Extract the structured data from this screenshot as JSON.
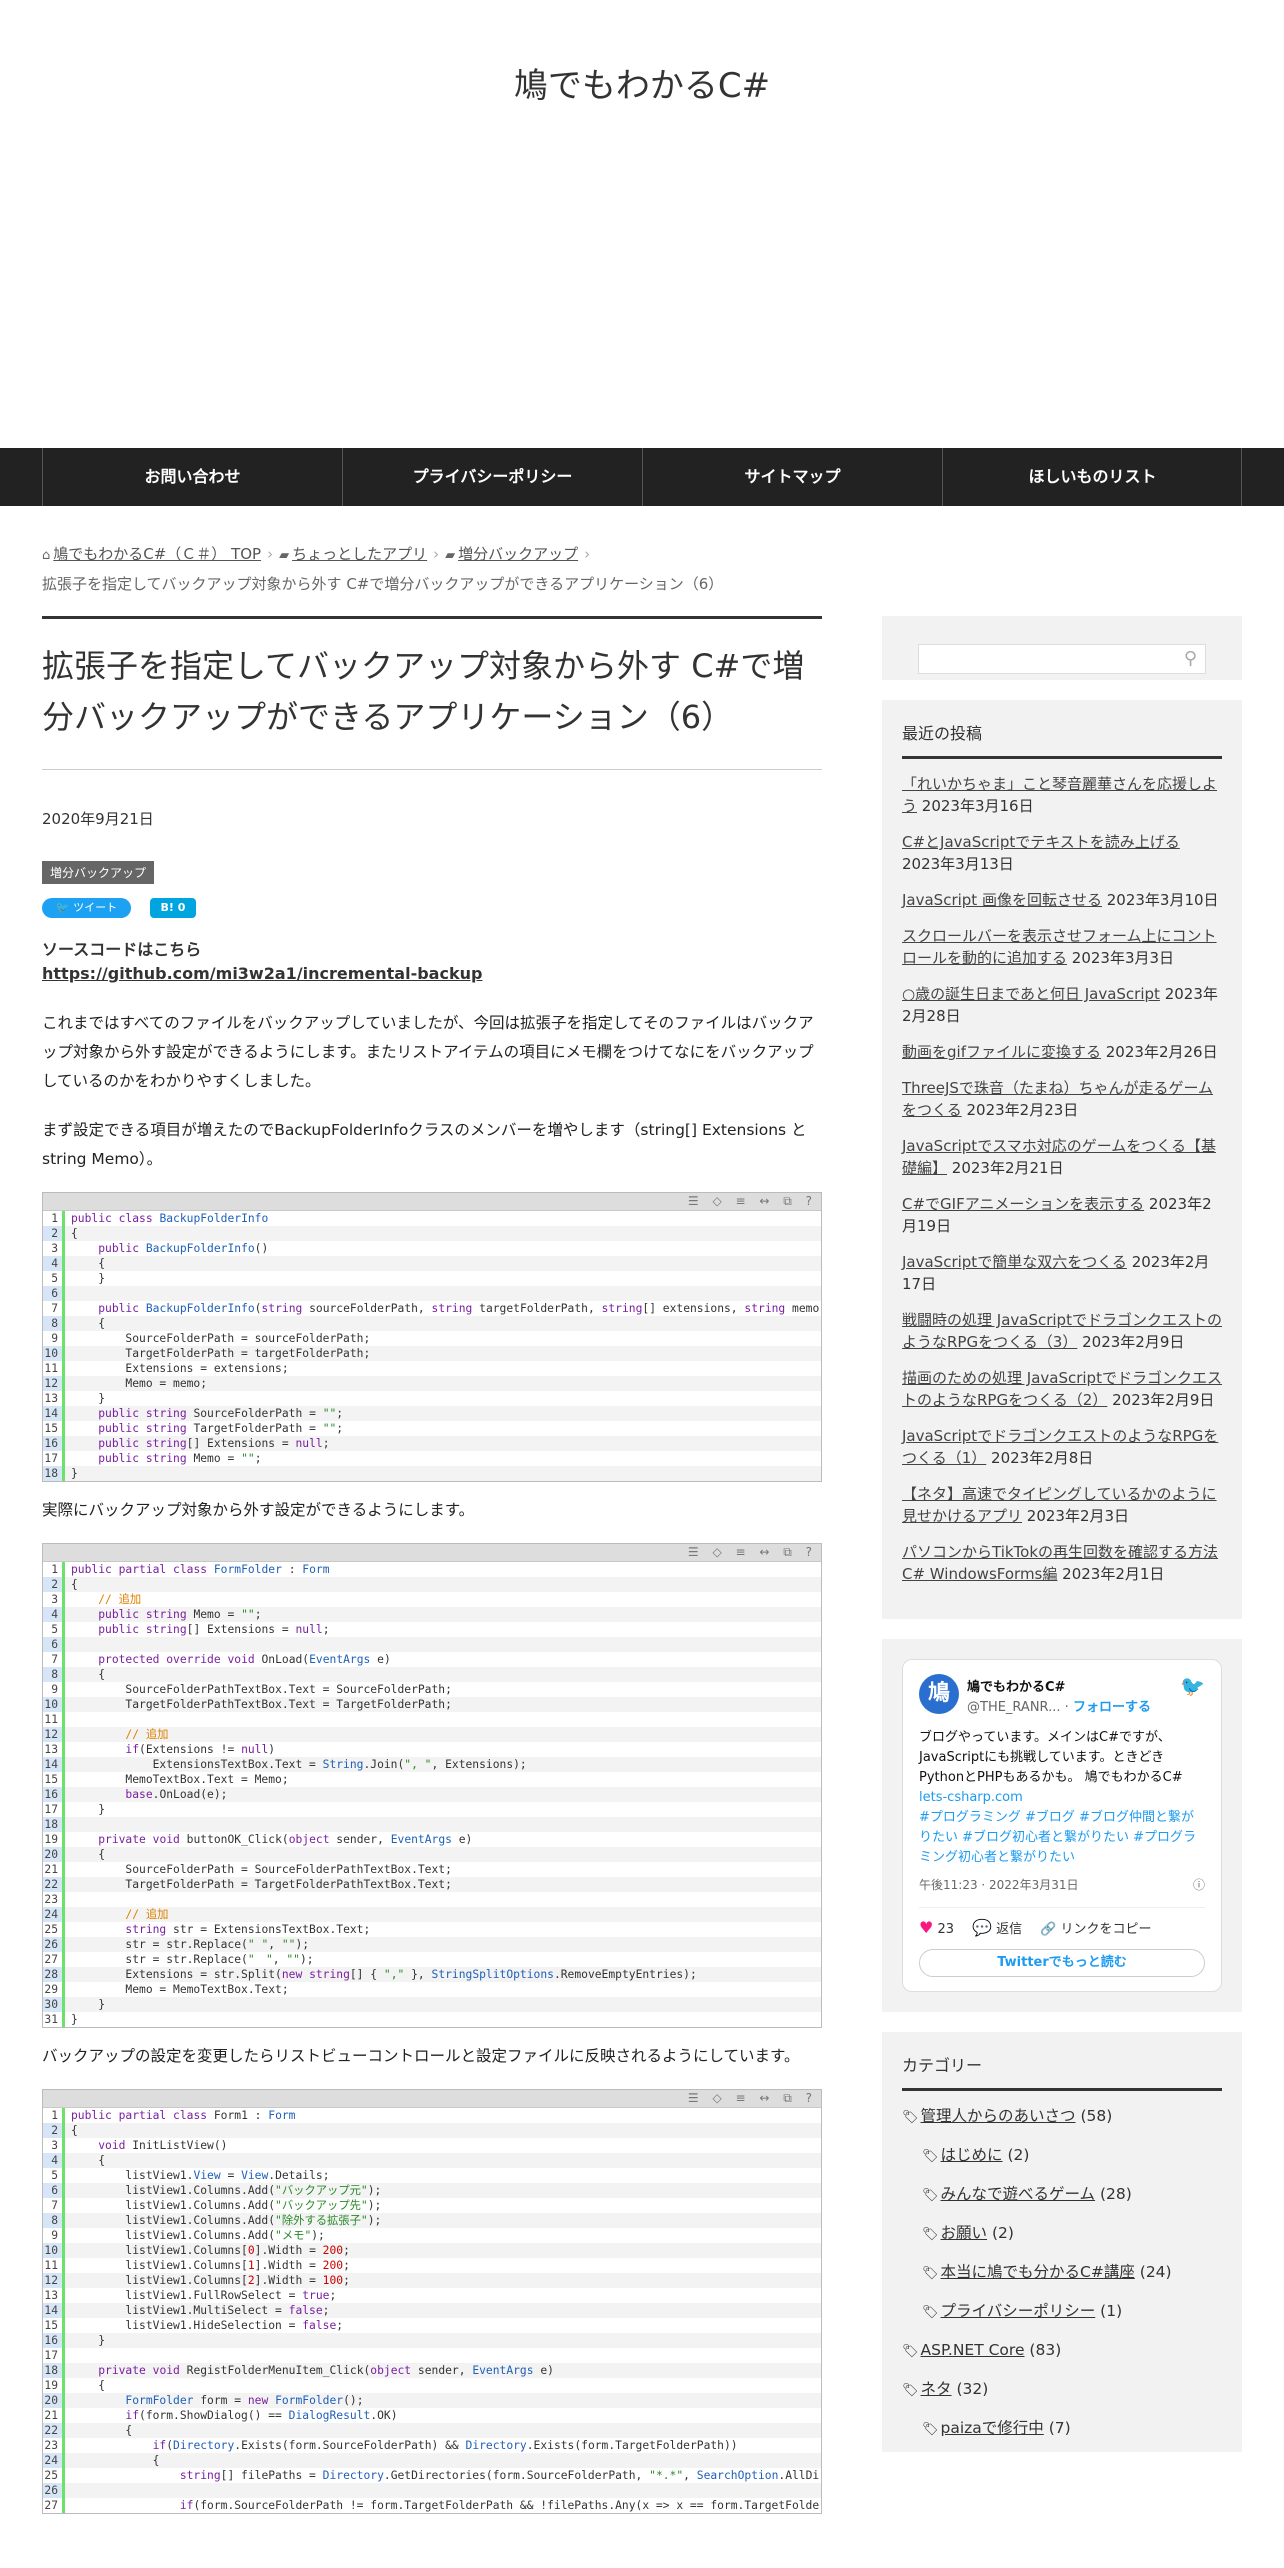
{
  "site": {
    "title": "鳩でもわかるC#"
  },
  "nav": [
    "お問い合わせ",
    "プライバシーポリシー",
    "サイトマップ",
    "ほしいものリスト"
  ],
  "breadcrumb": {
    "home": "鳩でもわかるC#（Ｃ＃） TOP",
    "cat1": "ちょっとしたアプリ",
    "cat2": "増分バックアップ",
    "current": "拡張子を指定してバックアップ対象から外す C#で増分バックアップができるアプリケーション（6）"
  },
  "entry": {
    "title": "拡張子を指定してバックアップ対象から外す C#で増分バックアップができるアプリケーション（6）",
    "date": "2020年9月21日",
    "tag": "増分バックアップ",
    "tweet_label": "ツイート",
    "hatena_label": "B!",
    "hatena_count": "0",
    "source_label": "ソースコードはこちら",
    "source_url": "https://github.com/mi3w2a1/incremental-backup",
    "para1": "これまではすべてのファイルをバックアップしていましたが、今回は拡張子を指定してそのファイルはバックアップ対象から外す設定ができるようにします。またリストアイテムの項目にメモ欄をつけてなにをバックアップしているのかをわかりやすくしました。",
    "para2": "まず設定できる項目が増えたのでBackupFolderInfoクラスのメンバーを増やします（string[] Extensions と string Memo）。",
    "para3": "実際にバックアップ対象から外す設定ができるようにします。",
    "para4": "バックアップの設定を変更したらリストビューコントロールと設定ファイルに反映されるようにしています。"
  },
  "code_blocks": [
    {
      "toolbar": "☰ ◇ ≡ ↔ ⧉ ?",
      "lines": [
        "public class BackupFolderInfo",
        "{",
        "    public BackupFolderInfo()",
        "    {",
        "    }",
        "",
        "    public BackupFolderInfo(string sourceFolderPath, string targetFolderPath, string[] extensions, string memo)",
        "    {",
        "        SourceFolderPath = sourceFolderPath;",
        "        TargetFolderPath = targetFolderPath;",
        "        Extensions = extensions;",
        "        Memo = memo;",
        "    }",
        "    public string SourceFolderPath = \"\";",
        "    public string TargetFolderPath = \"\";",
        "    public string[] Extensions = null;",
        "    public string Memo = \"\";",
        "}"
      ]
    },
    {
      "toolbar": "☰ ◇ ≡ ↔ ⧉ ?",
      "lines": [
        "public partial class FormFolder : Form",
        "{",
        "    // 追加",
        "    public string Memo = \"\";",
        "    public string[] Extensions = null;",
        "",
        "    protected override void OnLoad(EventArgs e)",
        "    {",
        "        SourceFolderPathTextBox.Text = SourceFolderPath;",
        "        TargetFolderPathTextBox.Text = TargetFolderPath;",
        "",
        "        // 追加",
        "        if(Extensions != null)",
        "            ExtensionsTextBox.Text = String.Join(\", \", Extensions);",
        "        MemoTextBox.Text = Memo;",
        "        base.OnLoad(e);",
        "    }",
        "",
        "    private void buttonOK_Click(object sender, EventArgs e)",
        "    {",
        "        SourceFolderPath = SourceFolderPathTextBox.Text;",
        "        TargetFolderPath = TargetFolderPathTextBox.Text;",
        "",
        "        // 追加",
        "        string str = ExtensionsTextBox.Text;",
        "        str = str.Replace(\" \", \"\");",
        "        str = str.Replace(\"　\", \"\");",
        "        Extensions = str.Split(new string[] { \",\" }, StringSplitOptions.RemoveEmptyEntries);",
        "        Memo = MemoTextBox.Text;",
        "    }",
        "}"
      ]
    },
    {
      "toolbar": "☰ ◇ ≡ ↔ ⧉ ?",
      "lines": [
        "public partial class Form1 : Form",
        "{",
        "    void InitListView()",
        "    {",
        "        listView1.View = View.Details;",
        "        listView1.Columns.Add(\"バックアップ元\");",
        "        listView1.Columns.Add(\"バックアップ先\");",
        "        listView1.Columns.Add(\"除外する拡張子\");",
        "        listView1.Columns.Add(\"メモ\");",
        "        listView1.Columns[0].Width = 200;",
        "        listView1.Columns[1].Width = 200;",
        "        listView1.Columns[2].Width = 100;",
        "        listView1.FullRowSelect = true;",
        "        listView1.MultiSelect = false;",
        "        listView1.HideSelection = false;",
        "    }",
        "",
        "    private void RegistFolderMenuItem_Click(object sender, EventArgs e)",
        "    {",
        "        FormFolder form = new FormFolder();",
        "        if(form.ShowDialog() == DialogResult.OK)",
        "        {",
        "            if(Directory.Exists(form.SourceFolderPath) && Directory.Exists(form.TargetFolderPath))",
        "            {",
        "                string[] filePaths = Directory.GetDirectories(form.SourceFolderPath, \"*.*\", SearchOption.AllDirectories);",
        "",
        "                if(form.SourceFolderPath != form.TargetFolderPath && !filePaths.Any(x => x == form.TargetFolderPath))"
      ]
    }
  ],
  "sidebar": {
    "search_icon": "search-icon",
    "recent_title": "最近の投稿",
    "recent": [
      {
        "title": "「れいかちゃま」こと琴音麗華さんを応援しよう",
        "date": "2023年3月16日"
      },
      {
        "title": "C#とJavaScriptでテキストを読み上げる",
        "date": "2023年3月13日"
      },
      {
        "title": "JavaScript 画像を回転させる",
        "date": "2023年3月10日"
      },
      {
        "title": "スクロールバーを表示させフォーム上にコントロールを動的に追加する",
        "date": "2023年3月3日"
      },
      {
        "title": "○歳の誕生日まであと何日 JavaScript",
        "date": "2023年2月28日"
      },
      {
        "title": "動画をgifファイルに変換する",
        "date": "2023年2月26日"
      },
      {
        "title": "ThreeJSで珠音（たまね）ちゃんが走るゲームをつくる",
        "date": "2023年2月23日"
      },
      {
        "title": "JavaScriptでスマホ対応のゲームをつくる【基礎編】",
        "date": "2023年2月21日"
      },
      {
        "title": "C#でGIFアニメーションを表示する",
        "date": "2023年2月19日"
      },
      {
        "title": "JavaScriptで簡単な双六をつくる",
        "date": "2023年2月17日"
      },
      {
        "title": "戦闘時の処理 JavaScriptでドラゴンクエストのようなRPGをつくる（3）",
        "date": "2023年2月9日"
      },
      {
        "title": "描画のための処理 JavaScriptでドラゴンクエストのようなRPGをつくる（2）",
        "date": "2023年2月9日"
      },
      {
        "title": "JavaScriptでドラゴンクエストのようなRPGをつくる（1）",
        "date": "2023年2月8日"
      },
      {
        "title": "【ネタ】高速でタイピングしているかのように見せかけるアプリ",
        "date": "2023年2月3日"
      },
      {
        "title": "パソコンからTikTokの再生回数を確認する方法 C# WindowsForms編",
        "date": "2023年2月1日"
      }
    ],
    "twitter": {
      "avatar_text": "鳩",
      "name": "鳩でもわかるC#",
      "handle": "@THE_RANR...",
      "follow": "フォローする",
      "text": "ブログやっています。メインはC#ですが、JavaScriptにも挑戦しています。ときどきPythonとPHPもあるかも。 鳩でもわかるC#",
      "link": "lets-csharp.com",
      "hashtags": "#プログラミング #ブログ #ブログ仲間と繋がりたい #ブログ初心者と繋がりたい #プログラミング初心者と繋がりたい",
      "time": "午後11:23 · 2022年3月31日",
      "likes": "23",
      "reply": "返信",
      "copy": "リンクをコピー",
      "more": "Twitterでもっと読む"
    },
    "cat_title": "カテゴリー",
    "categories": [
      {
        "name": "管理人からのあいさつ",
        "count": "(58)",
        "sub": false
      },
      {
        "name": "はじめに",
        "count": "(2)",
        "sub": true
      },
      {
        "name": "みんなで遊べるゲーム",
        "count": "(28)",
        "sub": true
      },
      {
        "name": "お願い",
        "count": "(2)",
        "sub": true
      },
      {
        "name": "本当に鳩でも分かるC#講座",
        "count": "(24)",
        "sub": true
      },
      {
        "name": "プライバシーポリシー",
        "count": "(1)",
        "sub": true
      },
      {
        "name": "ASP.NET Core",
        "count": "(83)",
        "sub": false
      },
      {
        "name": "ネタ",
        "count": "(32)",
        "sub": false
      },
      {
        "name": "paizaで修行中",
        "count": "(7)",
        "sub": true
      }
    ]
  }
}
